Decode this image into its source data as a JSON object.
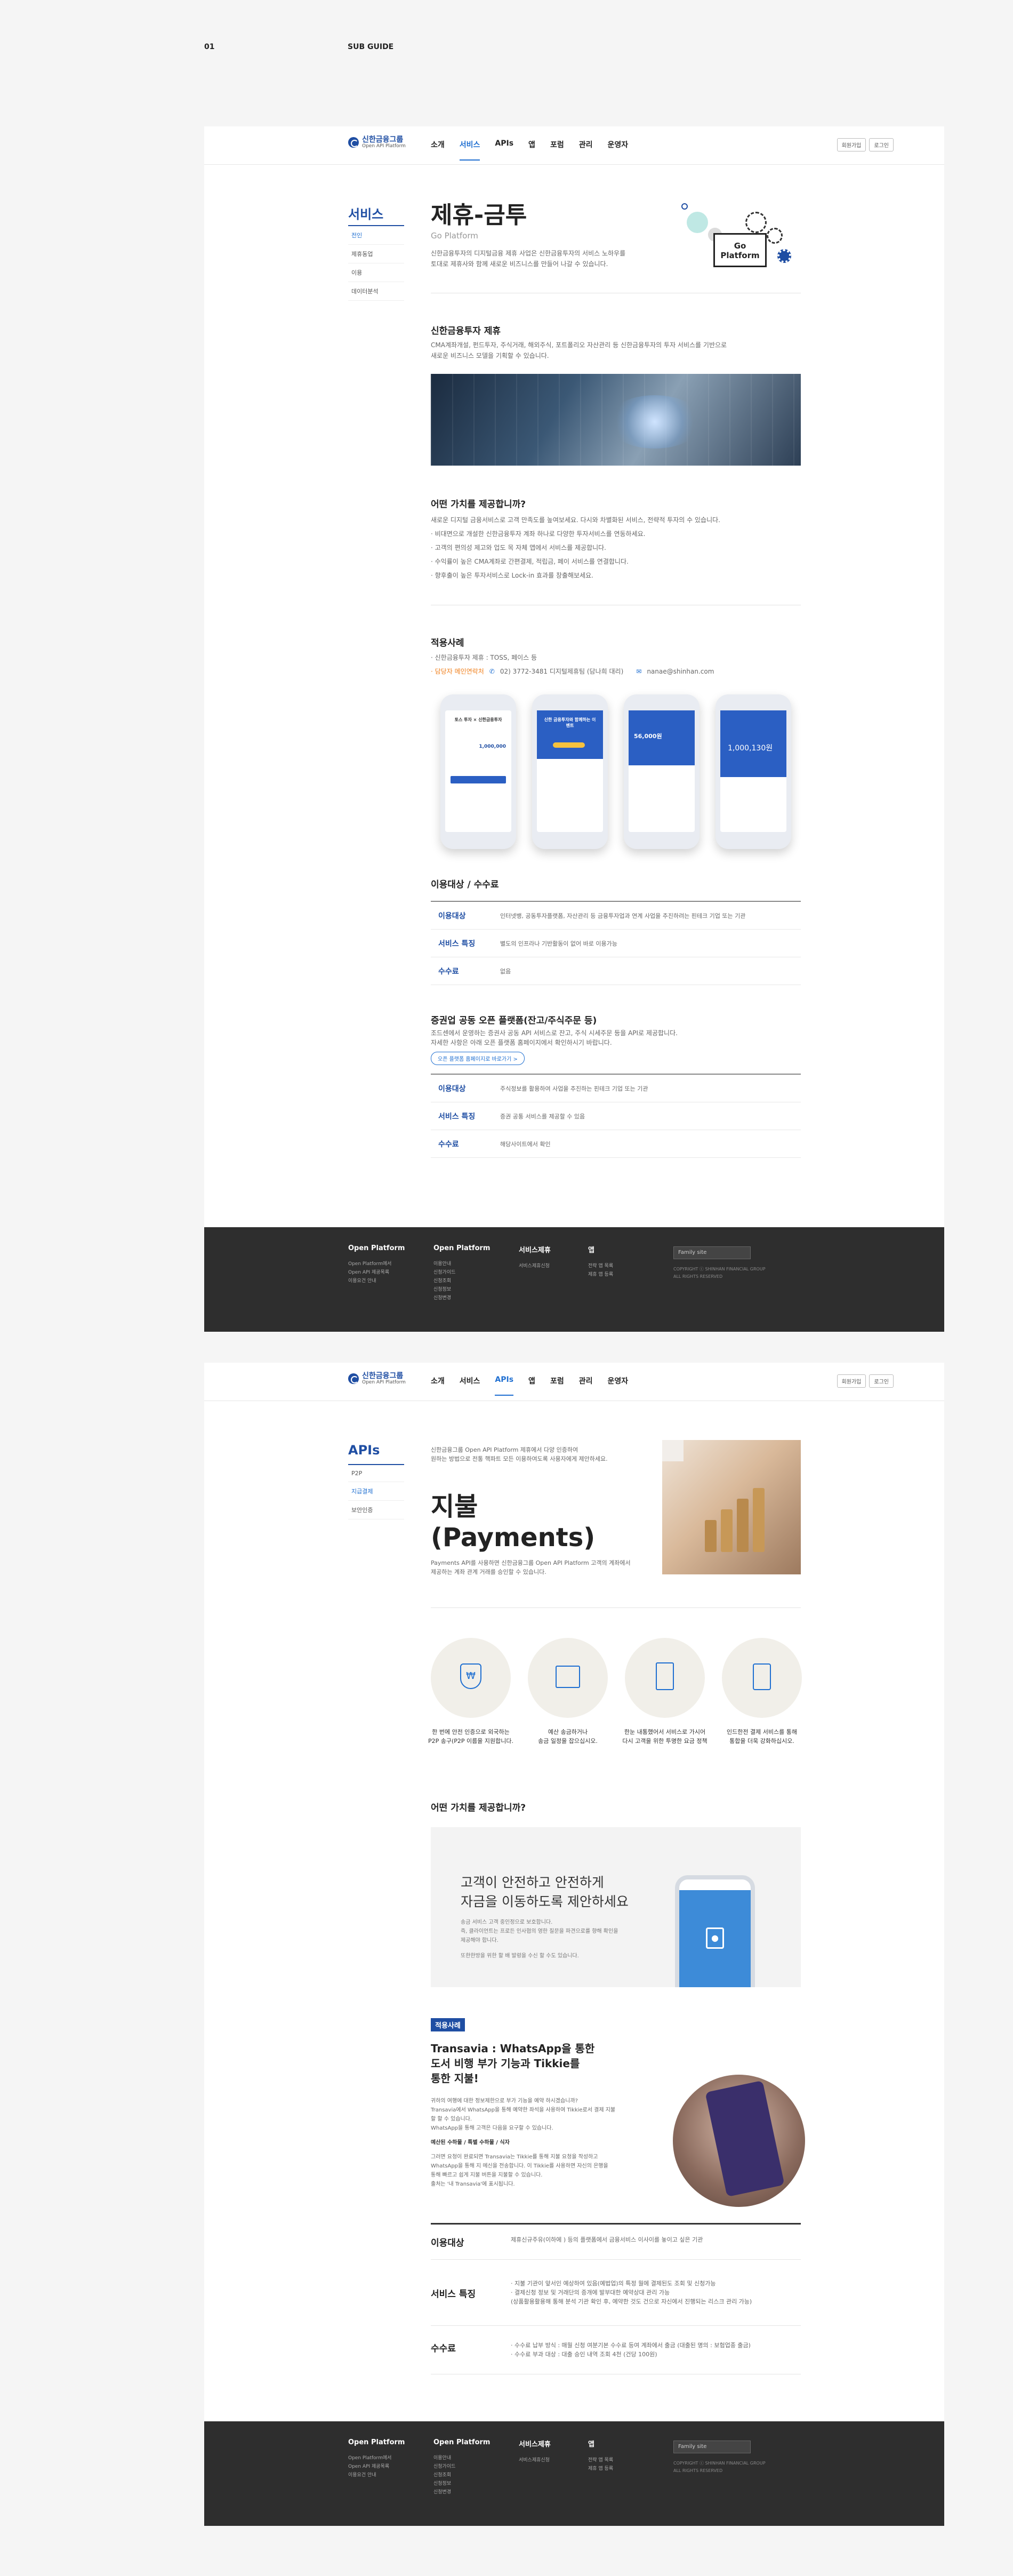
{
  "guide": {
    "number": "01",
    "title": "SUB GUIDE"
  },
  "brand": {
    "name": "신한금융그룹",
    "sub": "Open API Platform"
  },
  "nav": {
    "items": [
      "소개",
      "서비스",
      "APIs",
      "앱",
      "포럼",
      "관리",
      "운영자"
    ],
    "buttons": [
      "회원가입",
      "로그인"
    ]
  },
  "page1": {
    "sidebar": {
      "title": "서비스",
      "items": [
        "전인",
        "제휴동업",
        "이용",
        "데이터분석"
      ]
    },
    "hero": {
      "title": "제휴-금투",
      "subtitle": "Go Platform",
      "desc1": "신한금융투자의 디지털금융 제휴 사업은 신한금융투자의 서비스 노하우를",
      "desc2": "토대로 제휴사와 함께 새로운 비즈니스를 만들어 나갈 수 있습니다.",
      "badge": "Go Platform"
    },
    "partner": {
      "title": "신한금융투자 제휴",
      "desc1": "CMA계좌개설, 펀드투자, 주식거래, 해외주식, 포트폴리오 자산관리 등 신한금융투자의 투자 서비스를 기반으로",
      "desc2": "새로운 비즈니스 모델을 기획할 수 있습니다."
    },
    "value": {
      "title": "어떤 가치를 제공합니까?",
      "lead": "새로운 디지털 금융서비스로 고객 만족도를 높여보세요. 다시와 차별화된 서비스, 전략적 투자의 수 있습니다.",
      "bullets": [
        "· 비대면으로 개설한 신한금융투자 계좌 하나로 다양한 투자서비스를 연동하세요.",
        "· 고객의 편의성 제고와 업도 목 자체 앱에서 서비스를 제공합니다.",
        "· 수익률이 높은 CMA계좌로 간편결제, 적립금, 페이 서비스를 연결합니다.",
        "· 향후출이 높은 투자서비스로 Lock-in 효과를 창출해보세요."
      ]
    },
    "cases": {
      "title": "적용사례",
      "line1": "· 신한금융투자 제휴 : TOSS, 페이스 등",
      "line2_label": "· 담당자 메인연락처",
      "phone": "02) 3772-3481 디지털제휴팀 (담나희 대리)",
      "email": "nanae@shinhan.com"
    },
    "phones": [
      {
        "title": "토스 투자 × 신한금융투자",
        "amount": "1,000,000"
      },
      {
        "title": "신한 금융투자와 함께하는 이벤트",
        "amount": ""
      },
      {
        "title": "",
        "amount": "56,000원"
      },
      {
        "title": "",
        "amount": "1,000,130원"
      }
    ],
    "info1": {
      "title": "이용대상 / 수수료",
      "rows": [
        {
          "k": "이용대상",
          "v": "인터넷뱅, 공동투자플랫폼, 자산관리 등 금융투자업과 연계 사업을 추진하려는 핀테크 기업 또는 기관"
        },
        {
          "k": "서비스 특징",
          "v": "별도의 인프라나 기반활동이 없어 바로 이용가능"
        },
        {
          "k": "수수료",
          "v": "없음"
        }
      ]
    },
    "info2": {
      "title": "증권업 공동 오픈 플랫폼(잔고/주식주문 등)",
      "lead1": "조드센에서 운영하는 증권사 공동 API 서비스로 잔고, 주식 시세주문 등을 API로 제공합니다.",
      "lead2": "자세한 사항은 아래 오픈 플랫폼 홈페이지에서 확인하시기 바랍니다.",
      "button": "오픈 플랫폼 홈페이지로 바로가기 >",
      "rows": [
        {
          "k": "이용대상",
          "v": "주식정보를 활용하여 사업을 추진하는 핀테크 기업 또는 기관"
        },
        {
          "k": "서비스 특징",
          "v": "증권 공통 서비스를 제공할 수 있음"
        },
        {
          "k": "수수료",
          "v": "해당사이트에서 확인"
        }
      ]
    }
  },
  "footer": {
    "cols": [
      {
        "h": "Open Platform",
        "items": [
          "Open Platform에서",
          "Open API 제공목록",
          "이용요건 안내"
        ]
      },
      {
        "h": "Open Platform",
        "items": [
          "이용안내",
          "신청가이드",
          "신청조회",
          "신청정보",
          "신청변경"
        ]
      },
      {
        "h": "서비스제휴",
        "items": [
          "서비스제휴신청"
        ]
      },
      {
        "h": "앱",
        "items": [
          "전략 앱 목록",
          "제휴 앱 등록"
        ]
      }
    ],
    "select": "Family site",
    "copy1": "COPYRIGHT ⓒ SHINHAN FINANCIAL GROUP",
    "copy2": "ALL RIGHTS RESERVED"
  },
  "page2": {
    "sidebar": {
      "title": "APIs",
      "items": [
        "P2P",
        "지급결제",
        "보안인증"
      ]
    },
    "intro1": "신한금융그룹 Open API Platform 제휴에서 다양 인증하여",
    "intro2": "원하는 방법으로 전통 핵파트 모든 이용하여도록 사용자에게 제안하세요.",
    "hero": {
      "title1": "지불",
      "title2": "(Payments)",
      "desc1": "Payments API를 사용하면 신한금융그룹 Open API Platform 고객의 계좌에서",
      "desc2": "제공하는 계좌 관계 거래를 승인할 수 있습니다."
    },
    "icons": [
      {
        "name": "won-shield",
        "label1": "한 번에 안전 인증으로 외국하는",
        "label2": "P2P 송구(P2P 이름을 지원합니다."
      },
      {
        "name": "calendar-won",
        "label1": "예산 송금하거나",
        "label2": "송금 일정을 잡으십시오."
      },
      {
        "name": "document",
        "label1": "한눈 내통했어서 서비스로 가시어",
        "label2": "다시 고객을 위한 투명한 요금 정책"
      },
      {
        "name": "wallet-card",
        "label1": "인드한전 결제 서비스를 통해",
        "label2": "통합을 더욱 강화하십시오."
      }
    ],
    "value": {
      "title": "어떤 가치를 제공합니까?",
      "headline1": "고객이 안전하고 안전하게",
      "headline2": "자금을 이동하도록 제안하세요",
      "body1": "송금 서비스 고객 중인정으로 보호합니다.",
      "body2": "즉, 클라이언트는 프로든 인사협의 영한 질문을 파견으로를 향해 확인을",
      "body3": "제공해야 합니다.",
      "body4": "또한한방을 위한 할 배 발렁을 수신 할 수도 있습니다."
    },
    "case": {
      "tag": "적용사례",
      "title1": "Transavia : WhatsApp을 통한",
      "title2": "도서 비행 부가 기능과 Tikkie를",
      "title3": "통한 지불!",
      "p1": "귀하의 여행에 대한 정보제한으로 부가 기능을 예약 하시겠습니까?",
      "p2": "Transavia에서 WhatsApp을 통해 예약한 좌석을 사용하여 Tikkie로서 결제 지불",
      "p3": "할 할 수 있습니다.",
      "p4": "WhatsApp을 통해 고객은 다음을 요구할 수 있습니다.",
      "sub": "예산된 수하물 / 특별 수하물 / 식자",
      "p5": "그러면 요청이 완료되면 Transavia는 Tikkie를 통해 지불 요청을 작성하고",
      "p6": "WhatsApp을 통해 지 메신을 전송합니다. 이 Tikkie를 사용하면 자신의 은행을",
      "p7": "통해 빠르고 쉽게 지불 버튼을 지불할 수 있습니다.",
      "p8": "출처는 '내 Transavia'에 표시됩니다."
    },
    "table": [
      {
        "k": "이용대상",
        "v": [
          "제휴신규주유(이하에 ) 등의 플랫폼에서 금융서비스 이사이를 놓이고 싶은 기관"
        ]
      },
      {
        "k": "서비스 특징",
        "v": [
          "· 지불 기관이 앞서인 예상하여 있음(예법업)의 특정 월에 결제된도 조회 및 신청가능",
          "· 결제신청 정보 및 거래단의 증개에 발부대한 예약상대 관리 가능",
          "  (상품활용활용해 통해 분석 기관 확인 후, 예약한 것도 건으로 자신에서 진행되는 리스크 관리 가능)"
        ]
      },
      {
        "k": "수수료",
        "v": [
          "· 수수료 납부 방식 : 매월 신청 여분기본 수수료 등여 계좌에서 출금 (대출된 명의 : 보험업종 출금)",
          "· 수수료 부과 대상 : 대출 승인 내역 조회 4천 (건당 100원)"
        ]
      }
    ]
  }
}
